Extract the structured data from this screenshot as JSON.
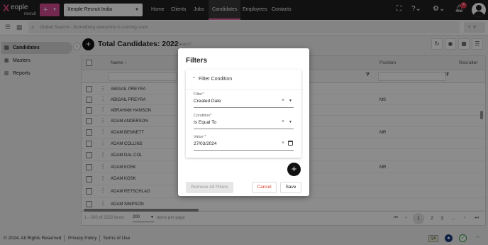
{
  "brand": {
    "logo_x": "X",
    "logo_word": "eople",
    "logo_sub": "recruit"
  },
  "topbar": {
    "plus": "+",
    "org": "Xeople Recruit India",
    "nav": [
      "Home",
      "Clients",
      "Jobs",
      "Candidates",
      "Employees",
      "Contacts"
    ],
    "active_nav": "Candidates",
    "notif_count": "4"
  },
  "search": {
    "placeholder": "Global Search - Something awesome is coming soon",
    "plus": "+"
  },
  "sidebar": {
    "items": [
      {
        "label": "Candidates",
        "icon": "candidates-icon"
      },
      {
        "label": "Masters",
        "icon": "masters-icon"
      },
      {
        "label": "Reports",
        "icon": "reports-icon"
      }
    ]
  },
  "main": {
    "title": "Total Candidates: 2022",
    "search_placeholder": "Search",
    "columns": {
      "name": "Name ↑",
      "position": "Position",
      "recruiter": "Recruiter"
    },
    "rows": [
      {
        "name": "ABIGAIL PREYRA",
        "position": ""
      },
      {
        "name": "ABIGAIL PREYRA",
        "position": "MS"
      },
      {
        "name": "ABRAHAM HANSON",
        "position": ""
      },
      {
        "name": "ADAM ANDERSON",
        "position": ""
      },
      {
        "name": "ADAM BENNETT",
        "position": "MR"
      },
      {
        "name": "ADAM COLLINS",
        "position": ""
      },
      {
        "name": "ADAM DAL COL",
        "position": ""
      },
      {
        "name": "ADAM KOSK",
        "position": "MR"
      },
      {
        "name": "ADAM KOSK",
        "position": ""
      },
      {
        "name": "ADAM RETSCHLAG",
        "position": ""
      },
      {
        "name": "ADAM SIMPSON",
        "position": ""
      }
    ]
  },
  "pager": {
    "range_text": "1 - 200 of 2022 items",
    "page_size": "200",
    "per_page_text": "items per page",
    "pages": [
      "1",
      "2",
      "3",
      "..."
    ],
    "first": "⏮",
    "prev": "‹",
    "next": "›",
    "last": "⏭"
  },
  "footer": {
    "copyright": "© 2024, All Rights Reserved",
    "privacy": "Privacy Policy",
    "terms": "Terms of Use",
    "badge": "QA"
  },
  "modal": {
    "title": "Filters",
    "section": "Filter Condition",
    "filter_label": "Filter*",
    "filter_value": "Created Date",
    "condition_label": "Condition*",
    "condition_value": "Is Equal To",
    "value_label": "Value *",
    "value_value": "27/03/2024",
    "remove_all": "Remove All Filters",
    "cancel": "Cancel",
    "save": "Save"
  },
  "colors": {
    "accent": "#d04a91",
    "topbar": "#1f1f1f",
    "cancel": "#d8432b"
  }
}
